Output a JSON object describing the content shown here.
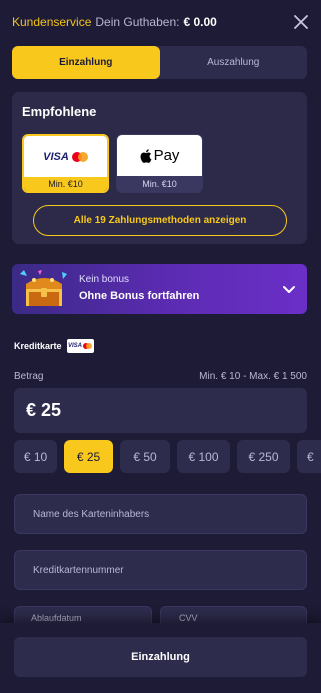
{
  "header": {
    "service_label": "Kundenservice",
    "balance_label": "Dein Guthaben:",
    "balance_value": "€ 0.00"
  },
  "tabs": [
    {
      "label": "Einzahlung",
      "active": true
    },
    {
      "label": "Auszahlung",
      "active": false
    }
  ],
  "recommended": {
    "title": "Empfohlene",
    "methods": [
      {
        "name": "VISA",
        "min": "Min. €10",
        "selected": true
      },
      {
        "name": "Pay",
        "min": "Min. €10",
        "selected": false
      }
    ],
    "all_methods_label": "Alle 19 Zahlungsmethoden anzeigen"
  },
  "bonus": {
    "kein_label": "Kein bonus",
    "continue_label": "Ohne Bonus fortfahren"
  },
  "payment": {
    "method_label": "Kreditkarte",
    "mini_logo": "VISA",
    "amount_label": "Betrag",
    "amount_range": "Min. € 10 - Max. € 1 500",
    "amount_value": "€ 25",
    "chips": [
      "€ 10",
      "€ 25",
      "€ 50",
      "€ 100",
      "€ 250",
      "€"
    ],
    "selected_chip": "€ 25",
    "cardholder_placeholder": "Name des Karteninhabers",
    "cardnumber_placeholder": "Kreditkartennummer",
    "expiry_placeholder": "Ablaufdatum",
    "cvv_placeholder": "CVV"
  },
  "footer": {
    "submit_label": "Einzahlung"
  },
  "colors": {
    "background": "#1d1b35",
    "accent": "#f8c81c",
    "surface": "#2e2c4d",
    "bonus_gradient_end": "#6b2fc8"
  }
}
